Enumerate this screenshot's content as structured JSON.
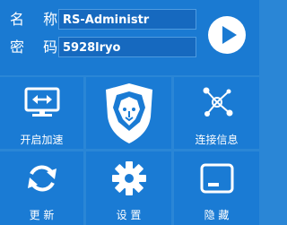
{
  "login": {
    "name_label": "名 称",
    "name_value": "RS-Administr",
    "password_label": "密 码",
    "password_value": "5928lryo"
  },
  "tiles": {
    "accelerate": {
      "label": "开启加速",
      "icon": "monitor-arrows-icon"
    },
    "logo": {
      "icon": "lion-shield-icon"
    },
    "connection": {
      "label": "连接信息",
      "icon": "network-nodes-icon"
    },
    "refresh": {
      "label": "更  新",
      "icon": "refresh-icon"
    },
    "settings": {
      "label": "设  置",
      "icon": "gear-icon"
    },
    "hide": {
      "label": "隐  藏",
      "icon": "minimize-window-icon"
    }
  },
  "colors": {
    "background": "#2a86d6",
    "tile": "#1a7bd4",
    "field": "#1669bf",
    "text": "#ffffff"
  }
}
